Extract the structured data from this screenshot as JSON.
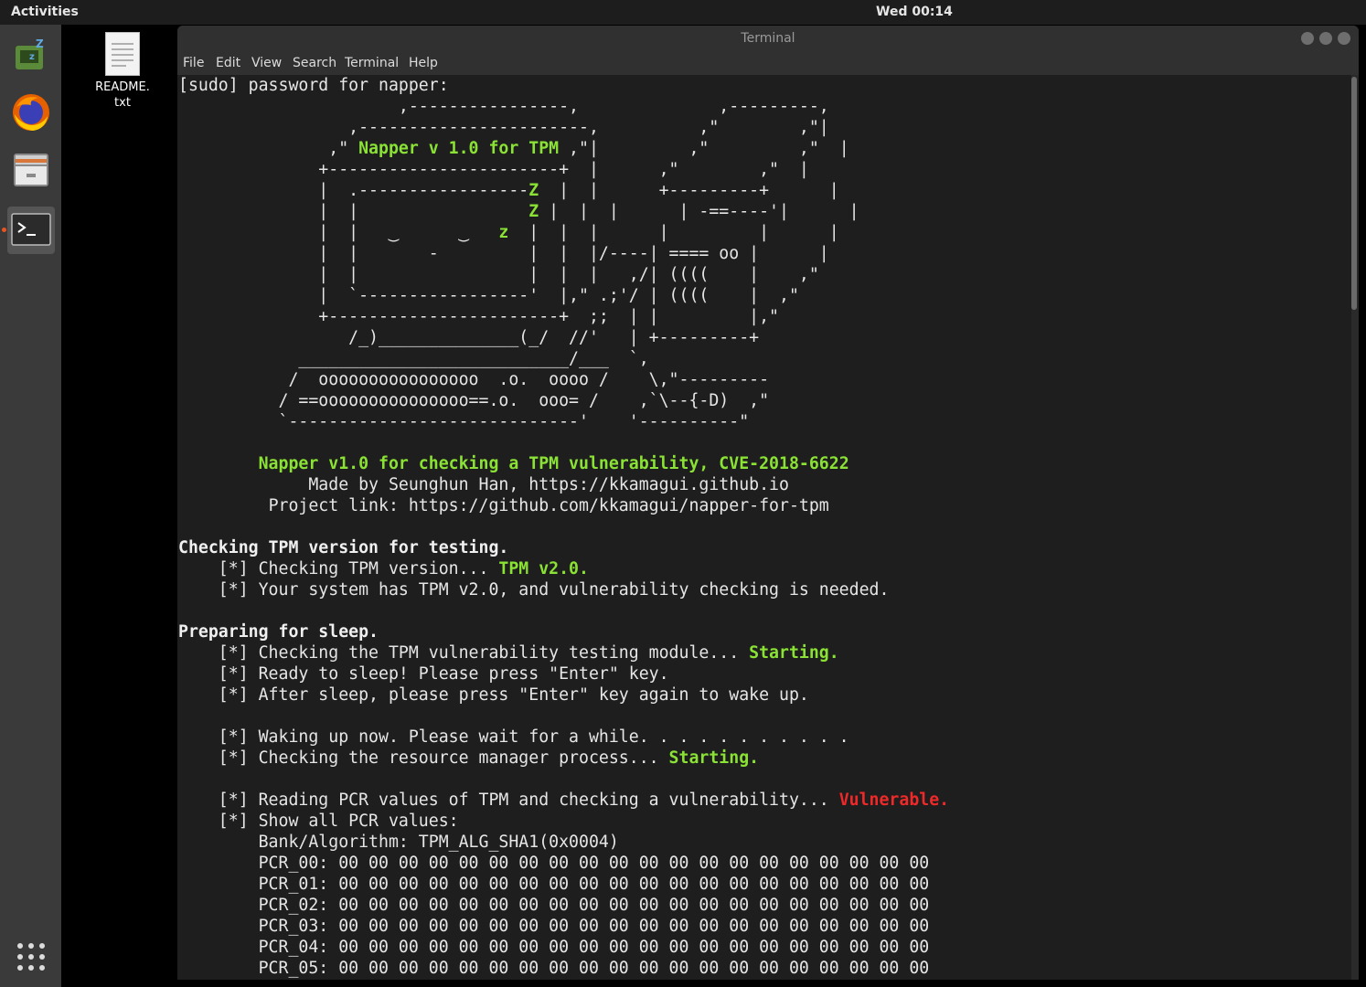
{
  "topbar": {
    "activities": "Activities",
    "clock": "Wed 00:14"
  },
  "dock": {
    "items": [
      {
        "name": "system-monitor"
      },
      {
        "name": "firefox"
      },
      {
        "name": "files"
      },
      {
        "name": "terminal"
      }
    ]
  },
  "desktop": {
    "file_label": "README.\ntxt"
  },
  "window": {
    "title": "Terminal",
    "menu": [
      "File",
      "Edit",
      "View",
      "Search",
      "Terminal",
      "Help"
    ]
  },
  "colors": {
    "accent_green": "#8ae234",
    "vuln_red": "#ef2929",
    "terminal_bg": "#1e1e1e"
  },
  "terminal": {
    "prompt": "[sudo] password for napper:",
    "art": [
      "                      ,----------------,              ,---------,",
      "                 ,-----------------------,          ,\"        ,\"|",
      "               ,\" ",
      "              +-----------------------+  |      ,\"        ,\"  |",
      "              |  .-----------------",
      "              |  |                 ",
      "              |  |   ‿      ‿ ",
      "              |  |       -         |  |  |/----| ==== oo |      |",
      "              |  |                 |  |  |   ,/| ((((    |    ,\"",
      "              |  `-----------------'  |,\" .;'/ | ((((    |  ,\"",
      "              +-----------------------+  ;;  | |         |,\"",
      "                 /_)______________(_/  //'   | +---------+",
      "            ___________________________/___  `,",
      "           /  oooooooooooooooo  .o.  oooo /    \\,\"---------",
      "          / ==ooooooooooooooo==.o.  ooo= /    ,`\\--{-D)  ,\"",
      "          `-----------------------------'    '----------\""
    ],
    "art_title": "Napper v 1.0 for TPM",
    "art_z_big": "Z",
    "art_z_small": "z",
    "banner_title": "Napper v1.0 for checking a TPM vulnerability, CVE-2018-6622",
    "banner_author": "Made by Seunghun Han, https://kkamagui.github.io",
    "banner_link": "Project link: https://github.com/kkamagui/napper-for-tpm",
    "sec1_heading": "Checking TPM version for testing.",
    "sec1_line1_text": "    [*] Checking TPM version... ",
    "sec1_line1_status": "TPM v2.0.",
    "sec1_line2": "    [*] Your system has TPM v2.0, and vulnerability checking is needed.",
    "sec2_heading": "Preparing for sleep.",
    "sec2_line1_text": "    [*] Checking the TPM vulnerability testing module... ",
    "sec2_line1_status": "Starting.",
    "sec2_line2": "    [*] Ready to sleep! Please press \"Enter\" key.",
    "sec2_line3": "    [*] After sleep, please press \"Enter\" key again to wake up.",
    "wake_line": "    [*] Waking up now. Please wait for a while. . . . . . . . . . .",
    "rm_line_text": "    [*] Checking the resource manager process... ",
    "rm_line_status": "Starting.",
    "pcr_line_text": "    [*] Reading PCR values of TPM and checking a vulnerability... ",
    "pcr_line_status": "Vulnerable.",
    "show_line": "    [*] Show all PCR values:",
    "bank_line": "        Bank/Algorithm: TPM_ALG_SHA1(0x0004)",
    "pcrs": [
      "        PCR_00: 00 00 00 00 00 00 00 00 00 00 00 00 00 00 00 00 00 00 00 00",
      "        PCR_01: 00 00 00 00 00 00 00 00 00 00 00 00 00 00 00 00 00 00 00 00",
      "        PCR_02: 00 00 00 00 00 00 00 00 00 00 00 00 00 00 00 00 00 00 00 00",
      "        PCR_03: 00 00 00 00 00 00 00 00 00 00 00 00 00 00 00 00 00 00 00 00",
      "        PCR_04: 00 00 00 00 00 00 00 00 00 00 00 00 00 00 00 00 00 00 00 00",
      "        PCR_05: 00 00 00 00 00 00 00 00 00 00 00 00 00 00 00 00 00 00 00 00"
    ]
  }
}
